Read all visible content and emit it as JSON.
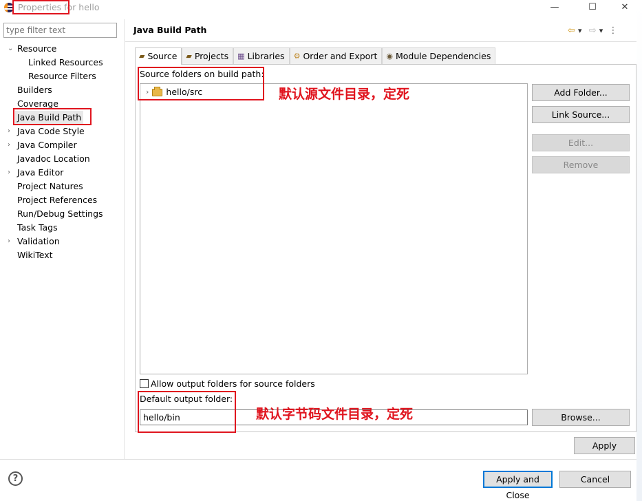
{
  "window": {
    "title": "Properties for hello",
    "minimize": "—",
    "maximize": "☐",
    "close": "✕"
  },
  "sidebar": {
    "filter_placeholder": "type filter text",
    "items": [
      {
        "label": "Resource",
        "expandable": true,
        "expanded": true
      },
      {
        "label": "Linked Resources"
      },
      {
        "label": "Resource Filters"
      },
      {
        "label": "Builders"
      },
      {
        "label": "Coverage"
      },
      {
        "label": "Java Build Path",
        "selected": true
      },
      {
        "label": "Java Code Style",
        "expandable": true
      },
      {
        "label": "Java Compiler",
        "expandable": true
      },
      {
        "label": "Javadoc Location"
      },
      {
        "label": "Java Editor",
        "expandable": true
      },
      {
        "label": "Project Natures"
      },
      {
        "label": "Project References"
      },
      {
        "label": "Run/Debug Settings"
      },
      {
        "label": "Task Tags"
      },
      {
        "label": "Validation",
        "expandable": true
      },
      {
        "label": "WikiText"
      }
    ]
  },
  "page": {
    "title": "Java Build Path",
    "nav_back": "⇦",
    "nav_dropdown": "▾",
    "nav_forward": "⇨",
    "nav_more": "⋮"
  },
  "tabs": [
    {
      "label": "Source",
      "icon": "source-folder-icon",
      "active": true
    },
    {
      "label": "Projects",
      "icon": "projects-icon"
    },
    {
      "label": "Libraries",
      "icon": "libraries-icon"
    },
    {
      "label": "Order and Export",
      "icon": "order-export-icon"
    },
    {
      "label": "Module Dependencies",
      "icon": "module-icon"
    }
  ],
  "source": {
    "folders_label": "Source folders on build path:",
    "folders": [
      {
        "name": "hello/src"
      }
    ],
    "buttons": {
      "add_folder": "Add Folder...",
      "link_source": "Link Source...",
      "edit": "Edit...",
      "remove": "Remove"
    },
    "allow_output_label": "Allow output folders for source folders",
    "allow_output_checked": false,
    "default_output_label": "Default output folder:",
    "default_output_value": "hello/bin",
    "browse": "Browse..."
  },
  "footer": {
    "apply": "Apply",
    "apply_close": "Apply and Close",
    "cancel": "Cancel",
    "help": "?"
  },
  "annotations": {
    "source_note": "默认源文件目录，定死",
    "output_note": "默认字节码文件目录，定死",
    "color": "#e0141e"
  }
}
